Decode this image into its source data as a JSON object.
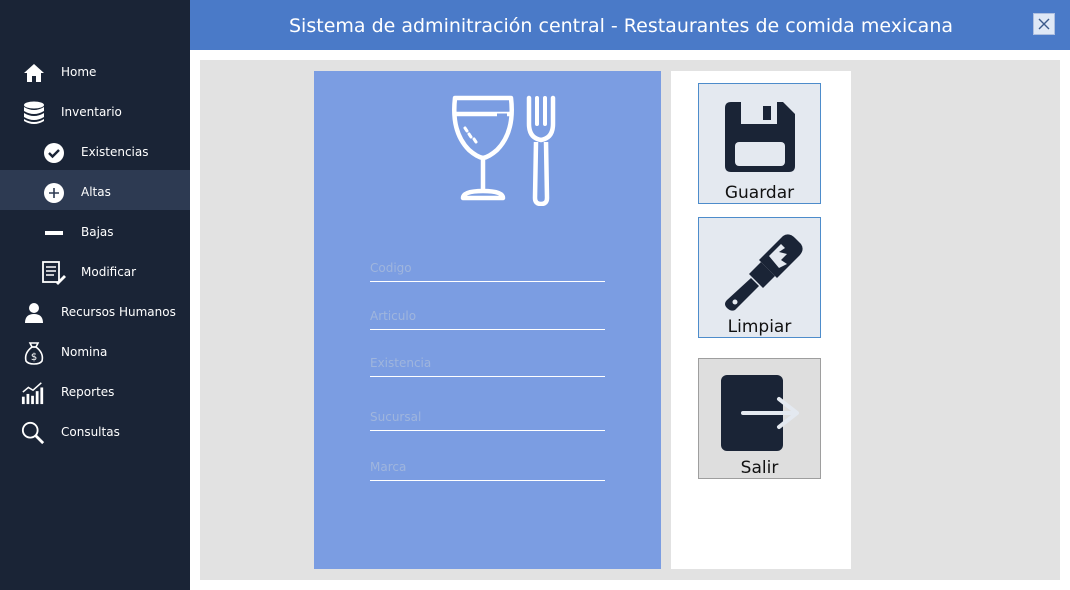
{
  "header": {
    "title": "Sistema de adminitración central - Restaurantes de comida mexicana",
    "close_icon": "close-icon"
  },
  "sidebar": {
    "items": [
      {
        "label": "Home",
        "icon": "home-icon"
      },
      {
        "label": "Inventario",
        "icon": "database-icon"
      },
      {
        "label": "Existencias",
        "icon": "checkmark-circle-icon"
      },
      {
        "label": "Altas",
        "icon": "plus-circle-icon",
        "active": true
      },
      {
        "label": "Bajas",
        "icon": "minus-icon"
      },
      {
        "label": "Modificar",
        "icon": "edit-list-icon"
      },
      {
        "label": "Recursos Humanos",
        "icon": "person-icon"
      },
      {
        "label": "Nomina",
        "icon": "money-bag-icon"
      },
      {
        "label": "Reportes",
        "icon": "bar-chart-icon"
      },
      {
        "label": "Consultas",
        "icon": "search-icon"
      }
    ]
  },
  "form": {
    "logo_icon": "wine-glass-fork-icon",
    "fields": [
      {
        "placeholder": "Codigo",
        "value": ""
      },
      {
        "placeholder": "Articulo",
        "value": ""
      },
      {
        "placeholder": "Existencia",
        "value": ""
      },
      {
        "placeholder": "Sucursal",
        "value": ""
      },
      {
        "placeholder": "Marca",
        "value": ""
      }
    ]
  },
  "actions": {
    "save_label": "Guardar",
    "clear_label": "Limpiar",
    "exit_label": "Salir"
  },
  "colors": {
    "sidebar_bg": "#1a2436",
    "header_bg": "#4a7ac8",
    "form_bg": "#7b9de2",
    "active_item_bg": "#2d3a52",
    "icon_dark": "#1a2436"
  }
}
